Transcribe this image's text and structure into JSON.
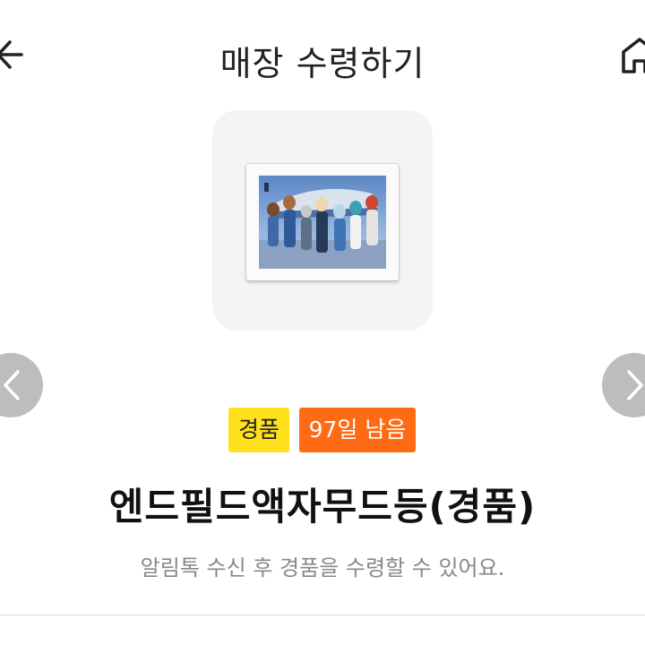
{
  "header": {
    "title": "매장 수령하기",
    "back_icon": "arrow-left-icon",
    "home_icon": "home-icon"
  },
  "product": {
    "image_alt": "framed poster product image",
    "badges": {
      "gift": "경품",
      "days_left": "97일 남음"
    },
    "name": "엔드필드액자무드등(경품)",
    "notice": "알림톡 수신 후 경품을 수령할 수 있어요."
  },
  "carousel": {
    "prev_icon": "chevron-left-icon",
    "next_icon": "chevron-right-icon"
  },
  "colors": {
    "badge_gift": "#ffe01c",
    "badge_days": "#ff6a14",
    "nav_button": "#bdbdbd",
    "notice_text": "#888888"
  }
}
